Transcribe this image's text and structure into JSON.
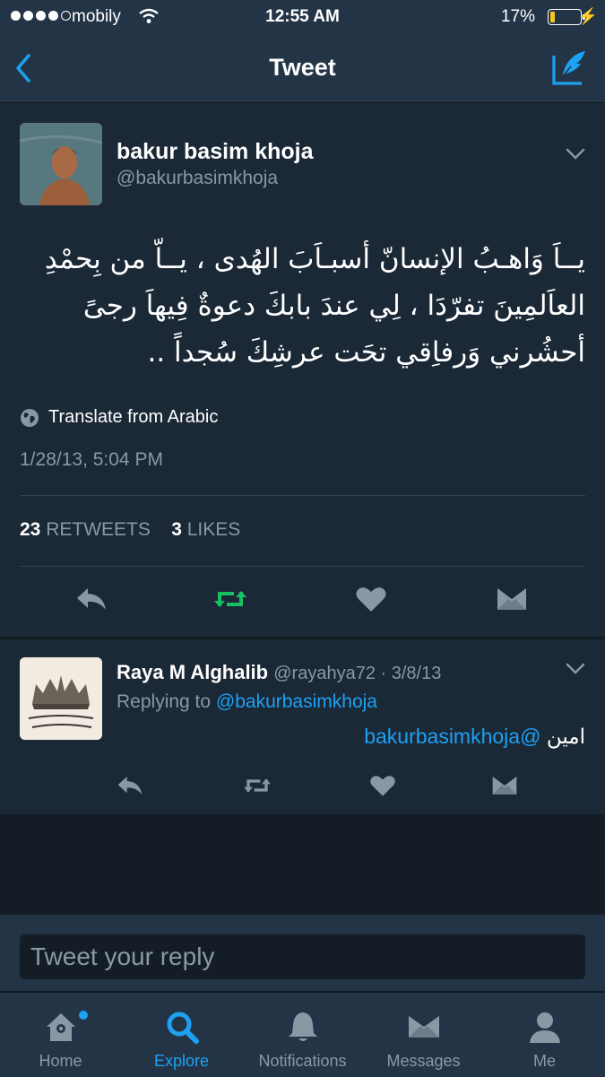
{
  "status_bar": {
    "carrier": "mobily",
    "time": "12:55 AM",
    "battery": "17%",
    "battery_level": 0.17
  },
  "nav": {
    "title": "Tweet",
    "icons": [
      "back-chevron-icon",
      "compose-icon"
    ]
  },
  "tweet": {
    "author_name": "bakur basim khoja",
    "author_handle": "@bakurbasimkhoja",
    "lines": [
      "يــاَ وَاهـبُ الإنسانّ أسبـاَبَ الهُدى ، يــاّ من بِحمْدِ",
      "العاَلمِينَ تفرّدَا ، لِي عندَ بابكَ دعوةٌ فِيهاَ رجىً",
      "أحشُرني وَرفاِقي تحَت عرشِكَ سُجداً .."
    ],
    "translate_label": "Translate from Arabic",
    "timestamp": "1/28/13, 5:04 PM",
    "retweets_count": "23",
    "retweets_label": "RETWEETS",
    "likes_count": "3",
    "likes_label": "LIKES"
  },
  "reply": {
    "author_name": "Raya M Alghalib",
    "author_handle": "@rayahya72",
    "date": "3/8/13",
    "replying_prefix": "Replying to",
    "replying_to": "@bakurbasimkhoja",
    "text": "امين",
    "mention": "@bakurbasimkhoja"
  },
  "composer": {
    "placeholder": "Tweet your reply"
  },
  "tabs": [
    {
      "label": "Home",
      "icon": "home-icon"
    },
    {
      "label": "Explore",
      "icon": "search-icon"
    },
    {
      "label": "Notifications",
      "icon": "bell-icon"
    },
    {
      "label": "Messages",
      "icon": "envelope-icon"
    },
    {
      "label": "Me",
      "icon": "person-icon"
    }
  ],
  "colors": {
    "accent": "#1da1f2",
    "retweet_active": "#17bf63",
    "background": "#141d26",
    "card": "#1b2836",
    "bar": "#243447",
    "secondary_text": "#8899a6"
  }
}
